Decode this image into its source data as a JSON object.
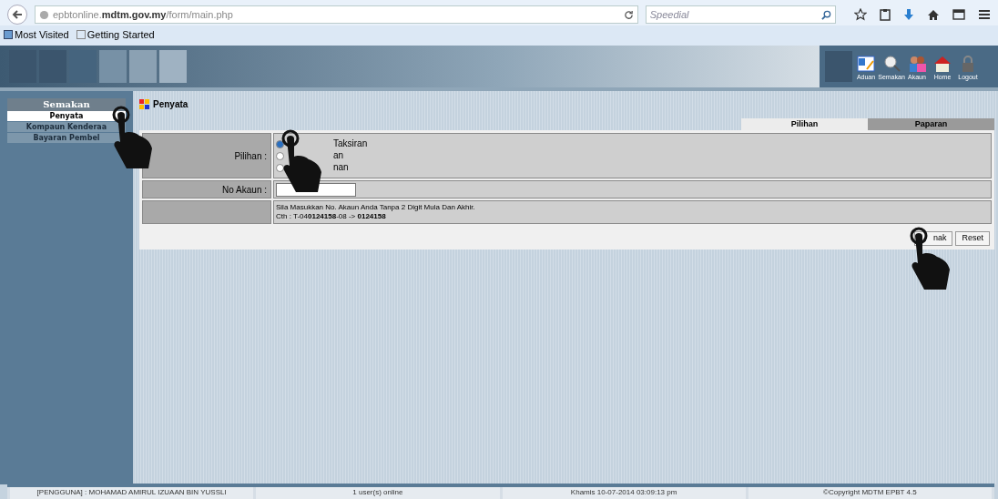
{
  "browser": {
    "url_host_prefix": "epbtonline.",
    "url_host": "mdtm.gov.my",
    "url_path": "/form/main.php",
    "search_placeholder": "Speedial",
    "bookmarks": [
      {
        "label": "Most Visited"
      },
      {
        "label": "Getting Started"
      }
    ]
  },
  "header_icons": [
    {
      "label": "Aduan",
      "kind": "form"
    },
    {
      "label": "Semakan",
      "kind": "search"
    },
    {
      "label": "Akaun",
      "kind": "people"
    },
    {
      "label": "Home",
      "kind": "house"
    },
    {
      "label": "Logout",
      "kind": "lock"
    }
  ],
  "sidebar": {
    "title": "Semakan",
    "items": [
      {
        "label": "Penyata",
        "selected": true
      },
      {
        "label": "Kompaun Kenderaa",
        "selected": false
      },
      {
        "label": "Bayaran Pembel",
        "selected": false
      }
    ]
  },
  "page_title": "Penyata",
  "tabs": [
    {
      "label": "Pilihan",
      "selected": true
    },
    {
      "label": "Paparan",
      "selected": false
    }
  ],
  "form": {
    "pilihan_label": "Pilihan :",
    "options": [
      {
        "label": "Taksiran",
        "checked": true
      },
      {
        "label": "an",
        "checked": false
      },
      {
        "label": "nan",
        "checked": false
      }
    ],
    "akaun_label": "No Akaun :",
    "hint_line_1": "Sila Masukkan No. Akaun Anda Tanpa 2 Digit Mula Dan Akhir.",
    "hint_line_2": "Cth : T-04**0124158**-08 -> **0124158**"
  },
  "buttons": [
    "nak",
    "Reset"
  ],
  "status_bar": [
    "[PENGGUNA] : MOHAMAD AMIRUL IZUAAN BIN YUSSLI",
    "1 user(s) online",
    "Khamis 10-07-2014 03:09:13 pm",
    "©Copyright MDTM EPBT 4.5"
  ]
}
